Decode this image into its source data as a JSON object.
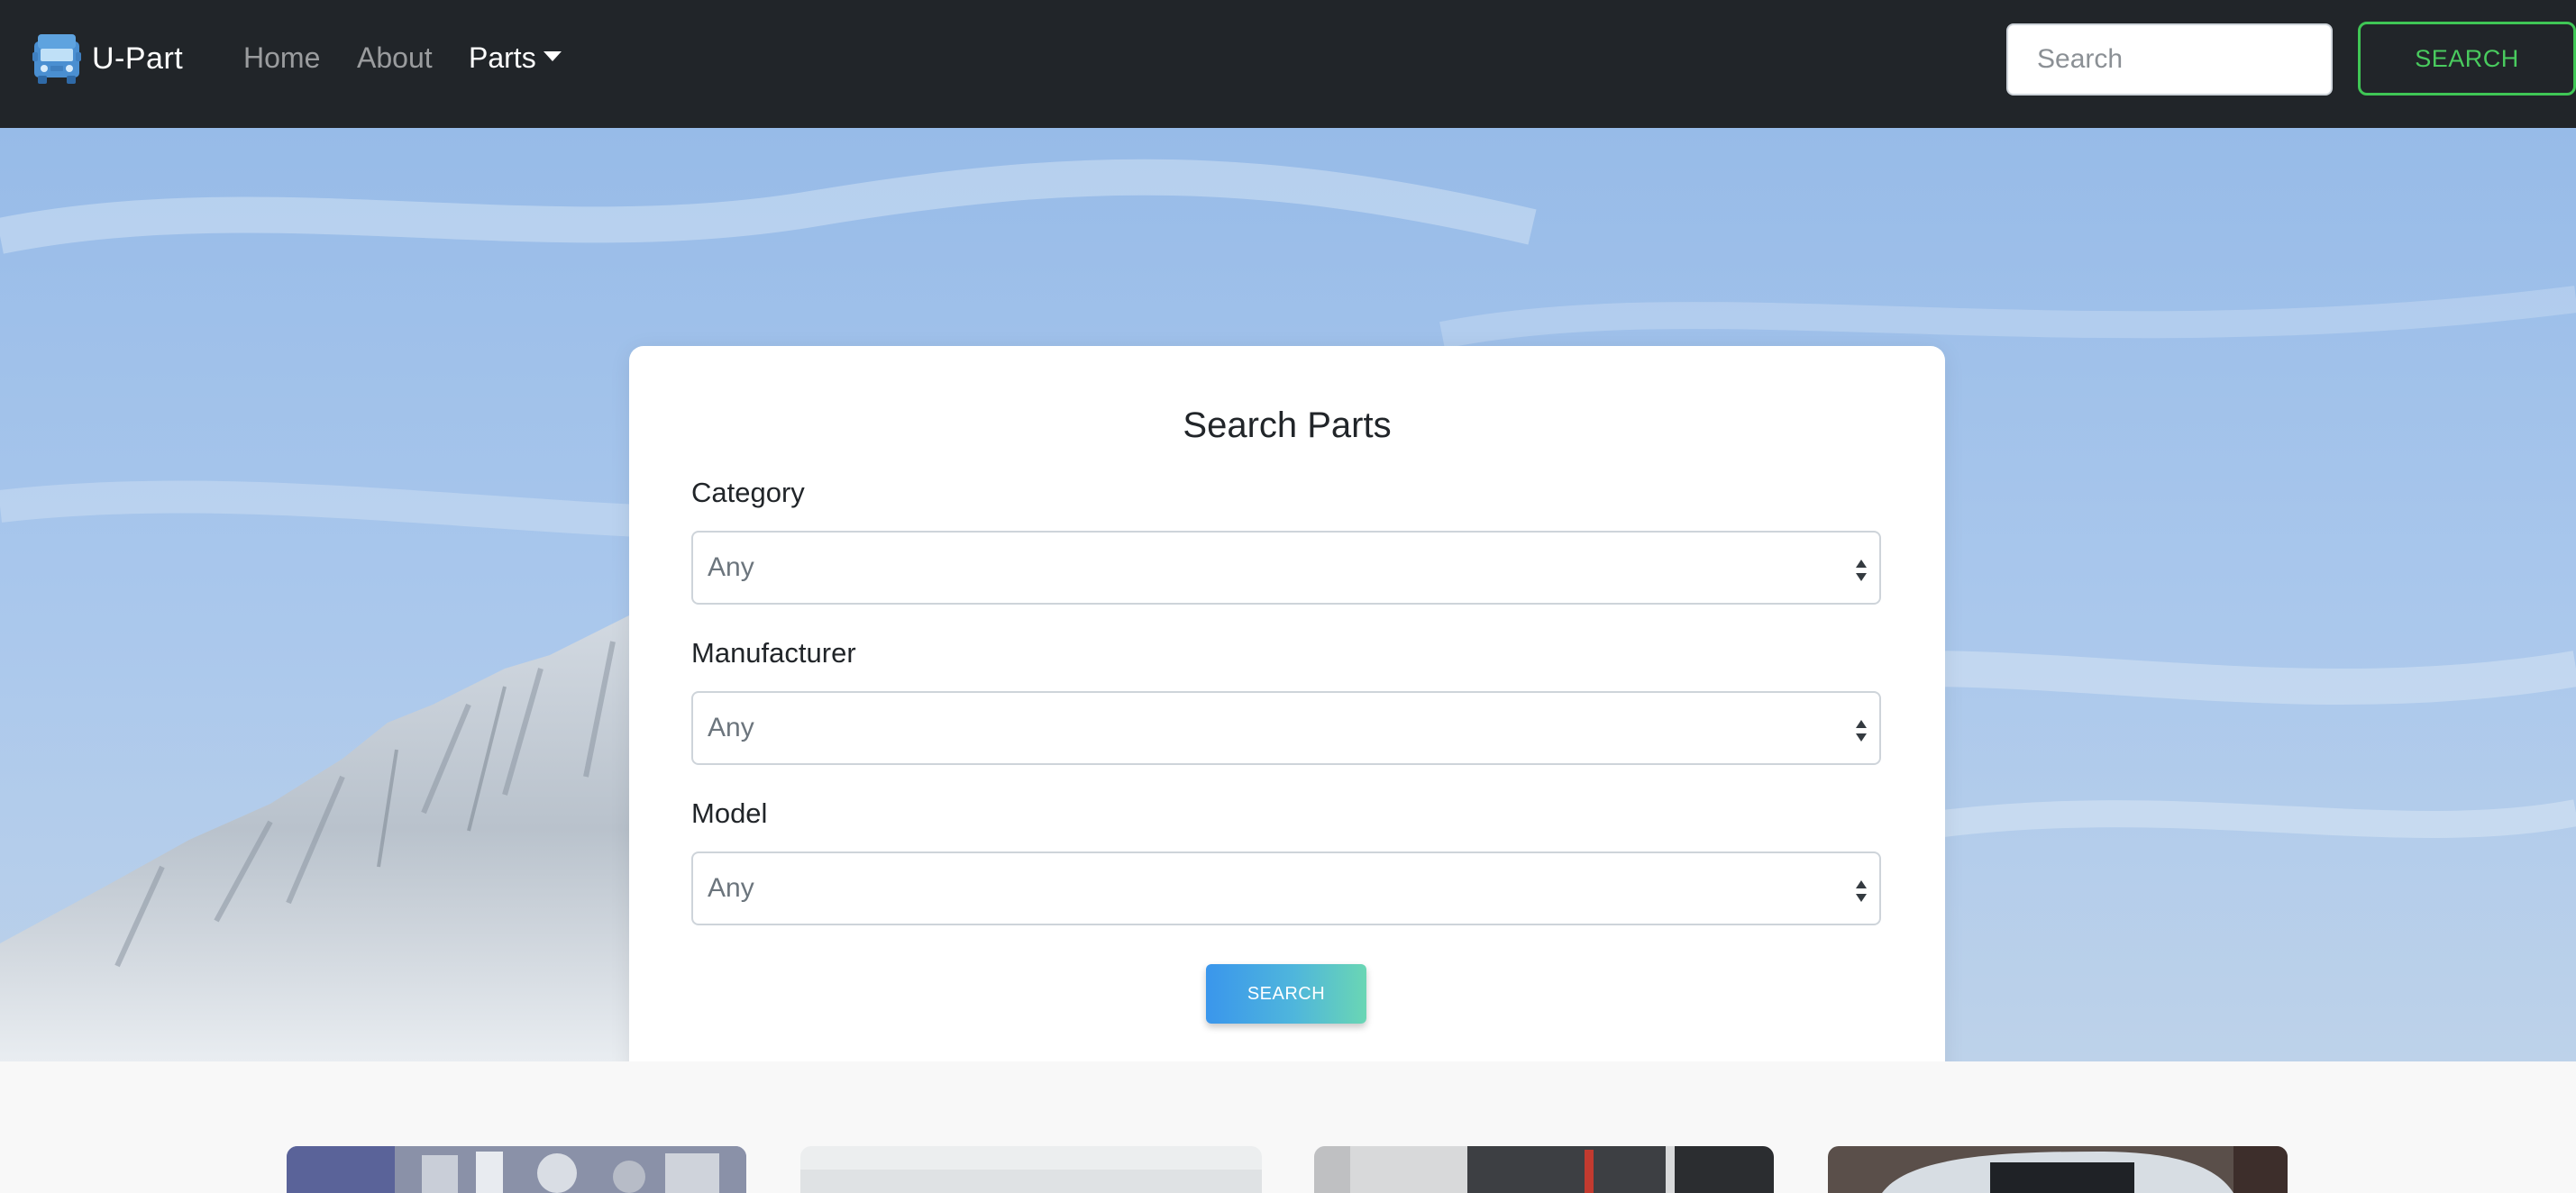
{
  "brand": {
    "name": "U-Part",
    "icon": "truck-icon"
  },
  "nav": {
    "home_label": "Home",
    "about_label": "About",
    "parts_label": "Parts",
    "search_placeholder": "Search",
    "search_button_label": "SEARCH"
  },
  "search_form": {
    "title": "Search Parts",
    "category_label": "Category",
    "category_value": "Any",
    "manufacturer_label": "Manufacturer",
    "manufacturer_value": "Any",
    "model_label": "Model",
    "model_value": "Any",
    "submit_label": "SEARCH"
  },
  "colors": {
    "navbar_bg": "#212529",
    "nav_search_button": "#3fc655",
    "submit_gradient_start": "#3a96ec",
    "submit_gradient_end": "#6ad6b4",
    "brand_icon": "#5b9bd5"
  }
}
